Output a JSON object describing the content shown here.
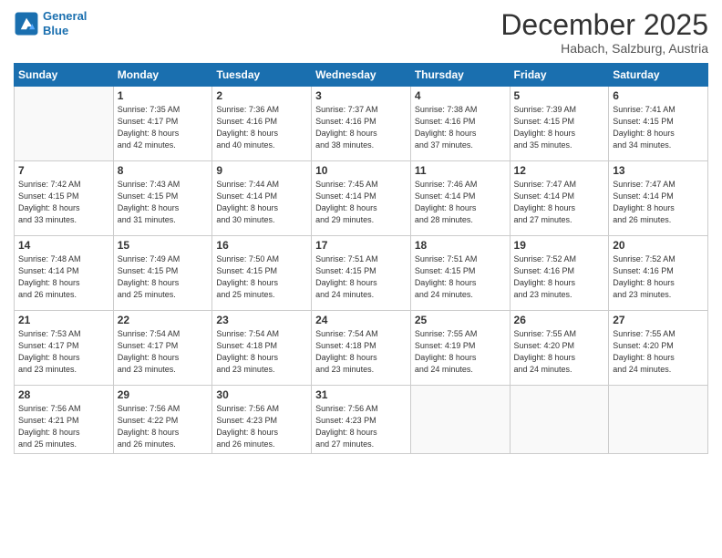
{
  "header": {
    "logo_line1": "General",
    "logo_line2": "Blue",
    "month": "December 2025",
    "location": "Habach, Salzburg, Austria"
  },
  "days_of_week": [
    "Sunday",
    "Monday",
    "Tuesday",
    "Wednesday",
    "Thursday",
    "Friday",
    "Saturday"
  ],
  "weeks": [
    [
      {
        "day": "",
        "info": ""
      },
      {
        "day": "1",
        "info": "Sunrise: 7:35 AM\nSunset: 4:17 PM\nDaylight: 8 hours\nand 42 minutes."
      },
      {
        "day": "2",
        "info": "Sunrise: 7:36 AM\nSunset: 4:16 PM\nDaylight: 8 hours\nand 40 minutes."
      },
      {
        "day": "3",
        "info": "Sunrise: 7:37 AM\nSunset: 4:16 PM\nDaylight: 8 hours\nand 38 minutes."
      },
      {
        "day": "4",
        "info": "Sunrise: 7:38 AM\nSunset: 4:16 PM\nDaylight: 8 hours\nand 37 minutes."
      },
      {
        "day": "5",
        "info": "Sunrise: 7:39 AM\nSunset: 4:15 PM\nDaylight: 8 hours\nand 35 minutes."
      },
      {
        "day": "6",
        "info": "Sunrise: 7:41 AM\nSunset: 4:15 PM\nDaylight: 8 hours\nand 34 minutes."
      }
    ],
    [
      {
        "day": "7",
        "info": "Sunrise: 7:42 AM\nSunset: 4:15 PM\nDaylight: 8 hours\nand 33 minutes."
      },
      {
        "day": "8",
        "info": "Sunrise: 7:43 AM\nSunset: 4:15 PM\nDaylight: 8 hours\nand 31 minutes."
      },
      {
        "day": "9",
        "info": "Sunrise: 7:44 AM\nSunset: 4:14 PM\nDaylight: 8 hours\nand 30 minutes."
      },
      {
        "day": "10",
        "info": "Sunrise: 7:45 AM\nSunset: 4:14 PM\nDaylight: 8 hours\nand 29 minutes."
      },
      {
        "day": "11",
        "info": "Sunrise: 7:46 AM\nSunset: 4:14 PM\nDaylight: 8 hours\nand 28 minutes."
      },
      {
        "day": "12",
        "info": "Sunrise: 7:47 AM\nSunset: 4:14 PM\nDaylight: 8 hours\nand 27 minutes."
      },
      {
        "day": "13",
        "info": "Sunrise: 7:47 AM\nSunset: 4:14 PM\nDaylight: 8 hours\nand 26 minutes."
      }
    ],
    [
      {
        "day": "14",
        "info": "Sunrise: 7:48 AM\nSunset: 4:14 PM\nDaylight: 8 hours\nand 26 minutes."
      },
      {
        "day": "15",
        "info": "Sunrise: 7:49 AM\nSunset: 4:15 PM\nDaylight: 8 hours\nand 25 minutes."
      },
      {
        "day": "16",
        "info": "Sunrise: 7:50 AM\nSunset: 4:15 PM\nDaylight: 8 hours\nand 25 minutes."
      },
      {
        "day": "17",
        "info": "Sunrise: 7:51 AM\nSunset: 4:15 PM\nDaylight: 8 hours\nand 24 minutes."
      },
      {
        "day": "18",
        "info": "Sunrise: 7:51 AM\nSunset: 4:15 PM\nDaylight: 8 hours\nand 24 minutes."
      },
      {
        "day": "19",
        "info": "Sunrise: 7:52 AM\nSunset: 4:16 PM\nDaylight: 8 hours\nand 23 minutes."
      },
      {
        "day": "20",
        "info": "Sunrise: 7:52 AM\nSunset: 4:16 PM\nDaylight: 8 hours\nand 23 minutes."
      }
    ],
    [
      {
        "day": "21",
        "info": "Sunrise: 7:53 AM\nSunset: 4:17 PM\nDaylight: 8 hours\nand 23 minutes."
      },
      {
        "day": "22",
        "info": "Sunrise: 7:54 AM\nSunset: 4:17 PM\nDaylight: 8 hours\nand 23 minutes."
      },
      {
        "day": "23",
        "info": "Sunrise: 7:54 AM\nSunset: 4:18 PM\nDaylight: 8 hours\nand 23 minutes."
      },
      {
        "day": "24",
        "info": "Sunrise: 7:54 AM\nSunset: 4:18 PM\nDaylight: 8 hours\nand 23 minutes."
      },
      {
        "day": "25",
        "info": "Sunrise: 7:55 AM\nSunset: 4:19 PM\nDaylight: 8 hours\nand 24 minutes."
      },
      {
        "day": "26",
        "info": "Sunrise: 7:55 AM\nSunset: 4:20 PM\nDaylight: 8 hours\nand 24 minutes."
      },
      {
        "day": "27",
        "info": "Sunrise: 7:55 AM\nSunset: 4:20 PM\nDaylight: 8 hours\nand 24 minutes."
      }
    ],
    [
      {
        "day": "28",
        "info": "Sunrise: 7:56 AM\nSunset: 4:21 PM\nDaylight: 8 hours\nand 25 minutes."
      },
      {
        "day": "29",
        "info": "Sunrise: 7:56 AM\nSunset: 4:22 PM\nDaylight: 8 hours\nand 26 minutes."
      },
      {
        "day": "30",
        "info": "Sunrise: 7:56 AM\nSunset: 4:23 PM\nDaylight: 8 hours\nand 26 minutes."
      },
      {
        "day": "31",
        "info": "Sunrise: 7:56 AM\nSunset: 4:23 PM\nDaylight: 8 hours\nand 27 minutes."
      },
      {
        "day": "",
        "info": ""
      },
      {
        "day": "",
        "info": ""
      },
      {
        "day": "",
        "info": ""
      }
    ]
  ]
}
